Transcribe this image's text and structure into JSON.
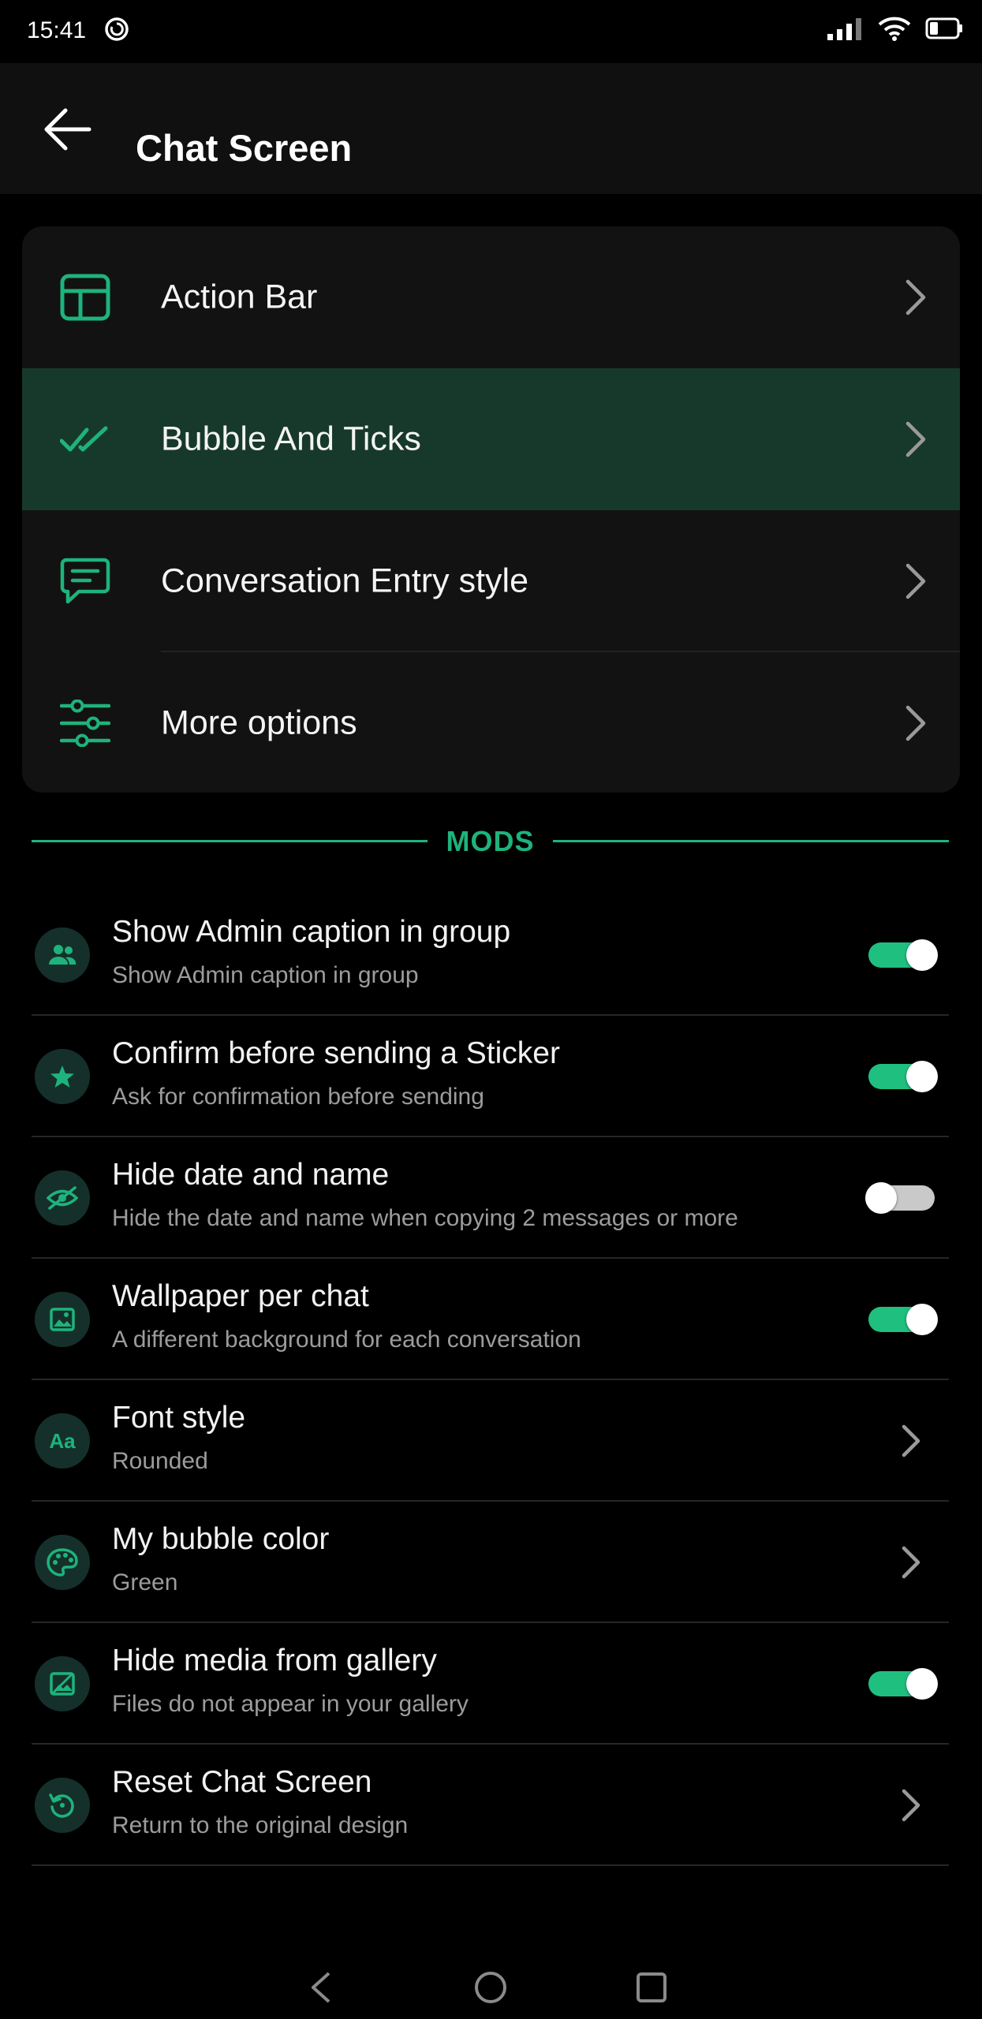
{
  "status_bar": {
    "time": "15:41"
  },
  "header": {
    "title": "Chat Screen"
  },
  "menu": {
    "items": [
      {
        "label": "Action Bar",
        "icon": "layout-icon"
      },
      {
        "label": "Bubble And Ticks",
        "icon": "double-check-icon",
        "selected": true
      },
      {
        "label": "Conversation Entry style",
        "icon": "chat-bubble-icon"
      },
      {
        "label": "More options",
        "icon": "sliders-icon"
      }
    ]
  },
  "section": {
    "title": "MODS"
  },
  "mods": [
    {
      "title": "Show Admin caption in group",
      "subtitle": "Show Admin caption in group",
      "control": "toggle",
      "on": true,
      "icon": "group-icon"
    },
    {
      "title": "Confirm before sending a Sticker",
      "subtitle": "Ask for confirmation before sending",
      "control": "toggle",
      "on": true,
      "icon": "star-icon"
    },
    {
      "title": "Hide date and name",
      "subtitle": "Hide the date and name when copying 2 messages or more",
      "control": "toggle",
      "on": false,
      "icon": "eye-off-icon"
    },
    {
      "title": "Wallpaper per chat",
      "subtitle": "A different background for each conversation",
      "control": "toggle",
      "on": true,
      "icon": "image-icon"
    },
    {
      "title": "Font style",
      "subtitle": "Rounded",
      "control": "chevron",
      "icon": "font-icon",
      "icon_text": "Aa"
    },
    {
      "title": "My bubble color",
      "subtitle": "Green",
      "control": "chevron",
      "icon": "palette-icon"
    },
    {
      "title": "Hide media from gallery",
      "subtitle": "Files do not appear in your gallery",
      "control": "toggle",
      "on": true,
      "icon": "hide-image-icon"
    },
    {
      "title": "Reset Chat Screen",
      "subtitle": "Return to the original design",
      "control": "chevron",
      "icon": "reset-icon"
    }
  ],
  "colors": {
    "accent": "#1eb37c",
    "selected_row": "#17392b",
    "toggle_on": "#1fc07f",
    "toggle_off": "#c9c9c9",
    "background": "#000000",
    "card": "#121212"
  }
}
